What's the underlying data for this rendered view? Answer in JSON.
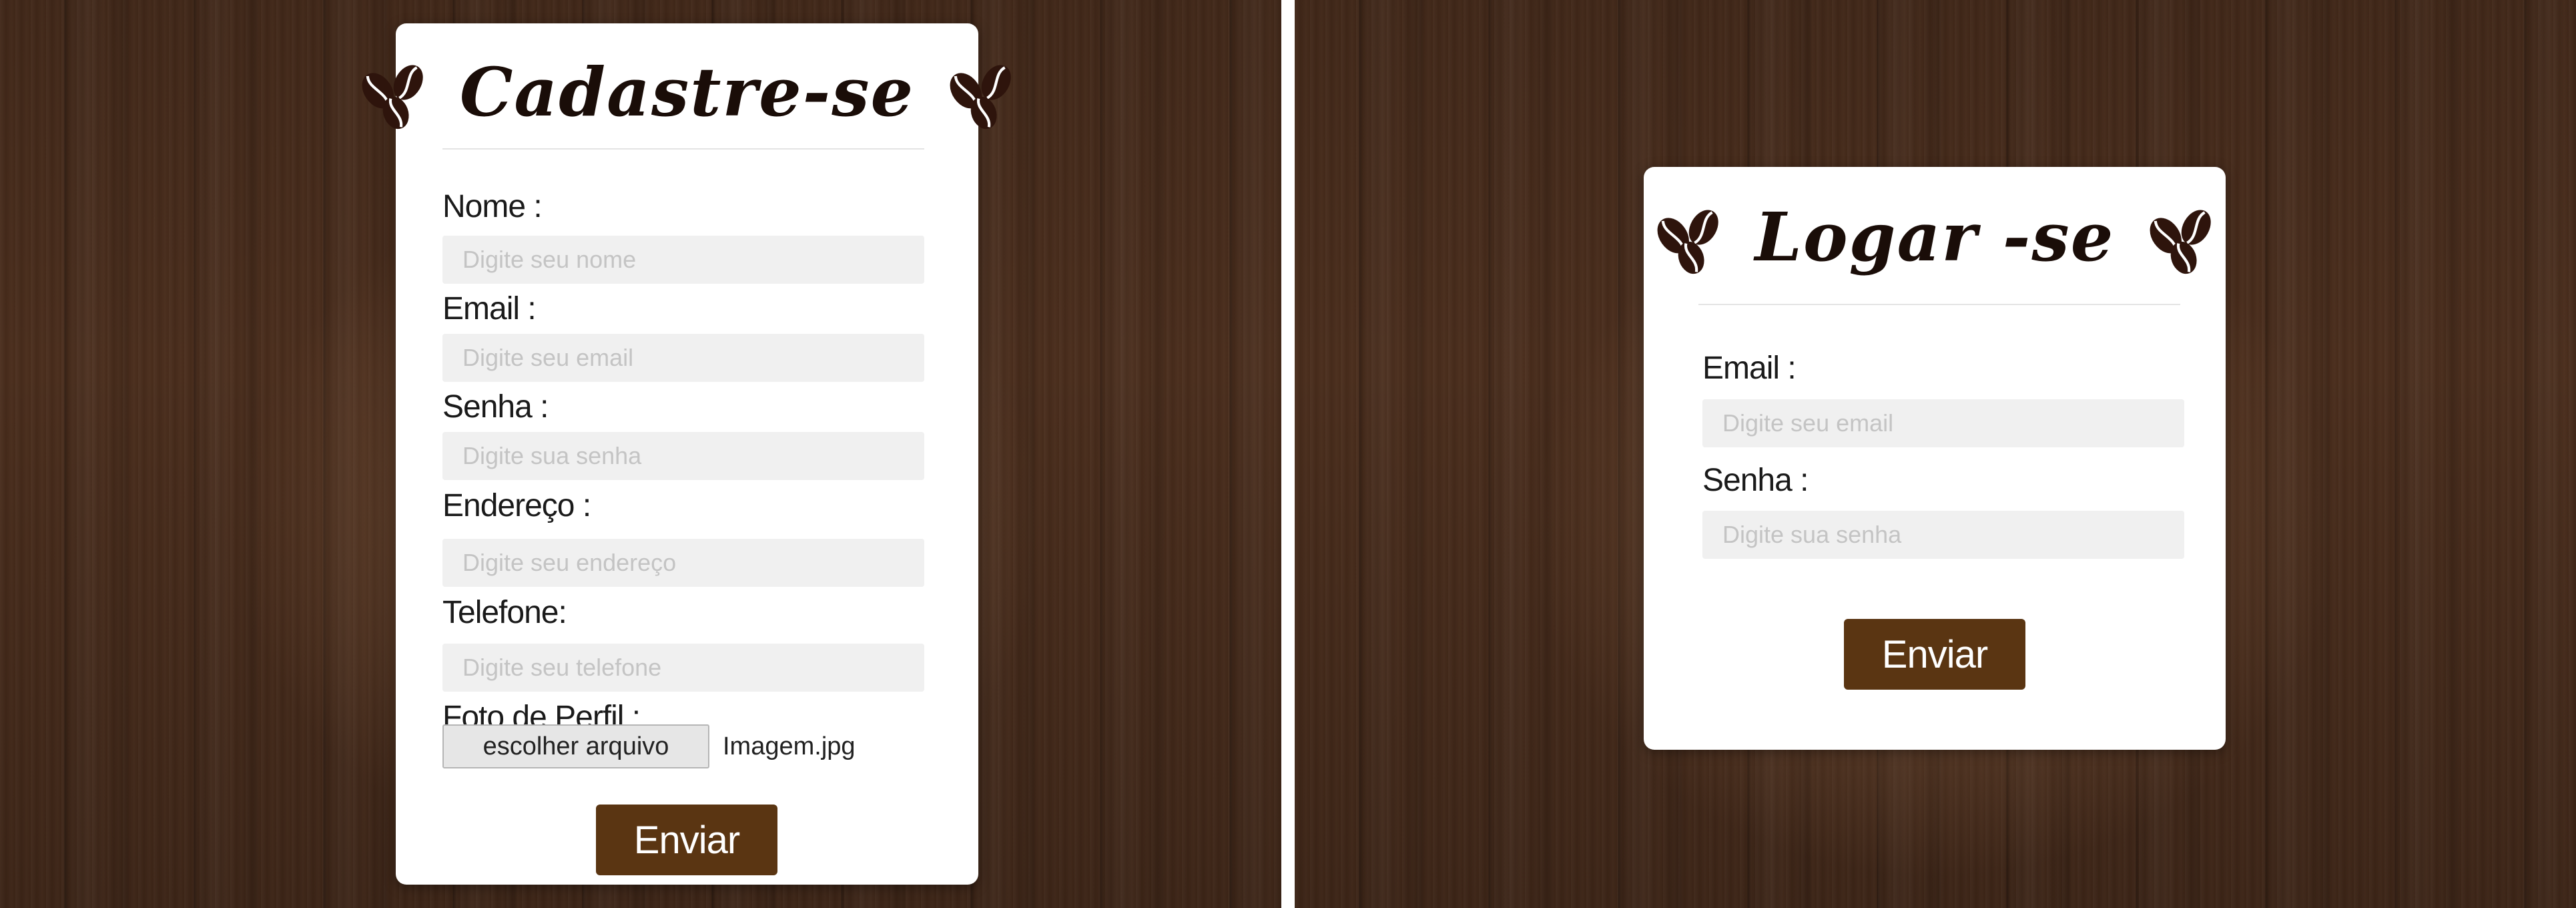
{
  "signup": {
    "title": "Cadastre-se",
    "fields": [
      {
        "label": "Nome :",
        "placeholder": "Digite seu nome"
      },
      {
        "label": "Email :",
        "placeholder": "Digite seu email"
      },
      {
        "label": "Senha :",
        "placeholder": "Digite sua senha"
      },
      {
        "label": "Endereço :",
        "placeholder": "Digite seu endereço"
      },
      {
        "label": "Telefone:",
        "placeholder": "Digite seu telefone"
      }
    ],
    "photo_label": "Foto de Perfil :",
    "file_button": "escolher arquivo",
    "file_name": "Imagem.jpg",
    "submit": "Enviar"
  },
  "login": {
    "title": "Logar -se",
    "fields": [
      {
        "label": "Email :",
        "placeholder": "Digite seu email"
      },
      {
        "label": "Senha :",
        "placeholder": "Digite sua senha"
      }
    ],
    "submit": "Enviar"
  },
  "icons": {
    "bean": "coffee-beans-icon"
  },
  "colors": {
    "accent_button": "#5a3512",
    "bean": "#2e140c",
    "input_bg": "#f0f0f0",
    "background_wood": "#4a2d1c"
  }
}
